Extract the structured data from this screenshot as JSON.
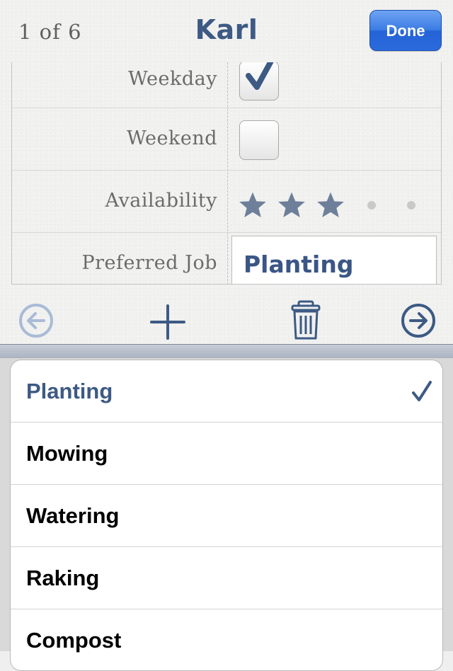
{
  "header": {
    "counter": "1 of 6",
    "title": "Karl",
    "done_label": "Done"
  },
  "form": {
    "rows": [
      {
        "label": "Weekday",
        "control": "checkbox",
        "checked": true
      },
      {
        "label": "Weekend",
        "control": "checkbox",
        "checked": false
      },
      {
        "label": "Availability",
        "control": "rating",
        "value": 3,
        "max": 5
      },
      {
        "label": "Preferred Job",
        "control": "select",
        "value": "Planting"
      }
    ]
  },
  "toolbar": {
    "icons": [
      "back-arrow-icon",
      "plus-icon",
      "trash-icon",
      "forward-arrow-icon"
    ]
  },
  "picker": {
    "selected": "Planting",
    "options": [
      "Planting",
      "Mowing",
      "Watering",
      "Raking",
      "Compost"
    ]
  },
  "colors": {
    "accent": "#3d5a84",
    "done_button": "#2a6bdc",
    "star": "#6e7f99"
  }
}
